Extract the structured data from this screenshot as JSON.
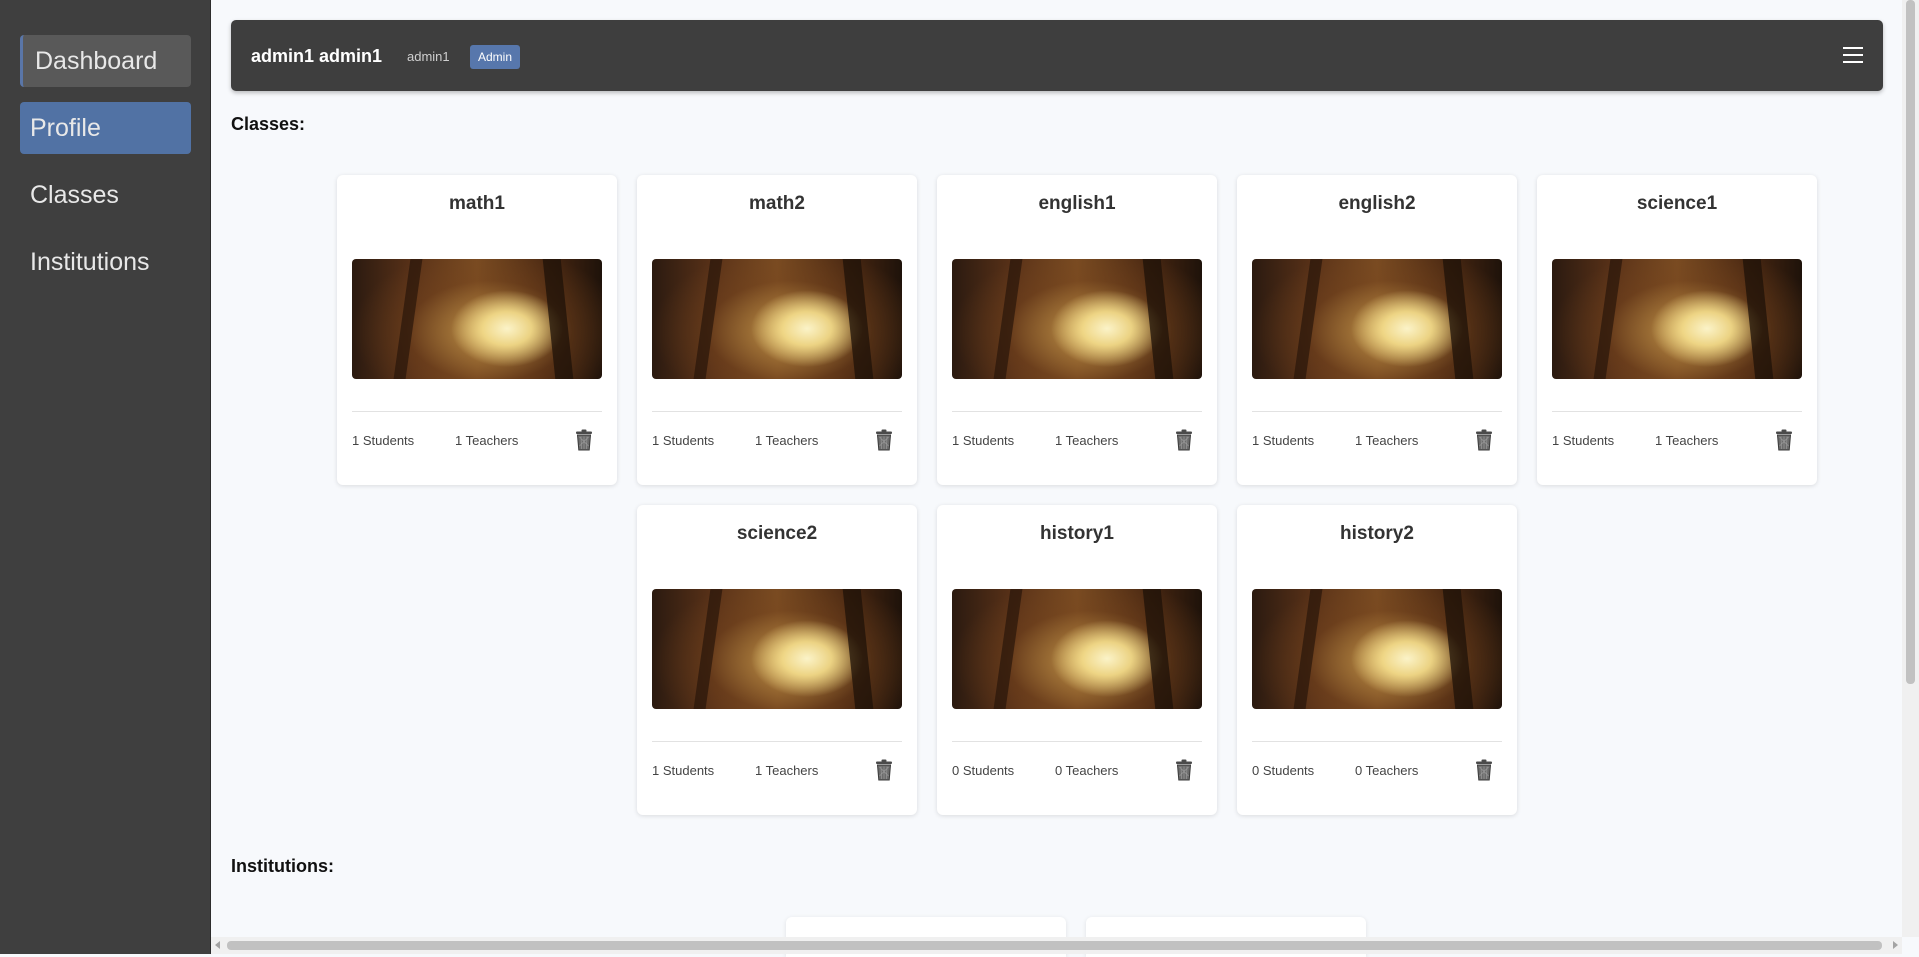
{
  "sidebar": {
    "items": [
      {
        "label": "Dashboard"
      },
      {
        "label": "Profile"
      },
      {
        "label": "Classes"
      },
      {
        "label": "Institutions"
      }
    ]
  },
  "header": {
    "user_full_name": "admin1 admin1",
    "username": "admin1",
    "role": "Admin",
    "menu_icon": "hamburger-icon"
  },
  "classes_section": {
    "title": "Classes:",
    "cards": [
      {
        "name": "math1",
        "students": "1 Students",
        "teachers": "1 Teachers"
      },
      {
        "name": "math2",
        "students": "1 Students",
        "teachers": "1 Teachers"
      },
      {
        "name": "english1",
        "students": "1 Students",
        "teachers": "1 Teachers"
      },
      {
        "name": "english2",
        "students": "1 Students",
        "teachers": "1 Teachers"
      },
      {
        "name": "science1",
        "students": "1 Students",
        "teachers": "1 Teachers"
      },
      {
        "name": "science2",
        "students": "1 Students",
        "teachers": "1 Teachers"
      },
      {
        "name": "history1",
        "students": "0 Students",
        "teachers": "0 Teachers"
      },
      {
        "name": "history2",
        "students": "0 Students",
        "teachers": "0 Teachers"
      }
    ]
  },
  "institutions_section": {
    "title": "Institutions:"
  },
  "colors": {
    "sidebar_bg": "#3f3f3f",
    "active_nav": "#5172a4",
    "header_bg": "#3e3e3e",
    "badge_bg": "#5777ac",
    "page_bg": "#f7f9fc"
  }
}
